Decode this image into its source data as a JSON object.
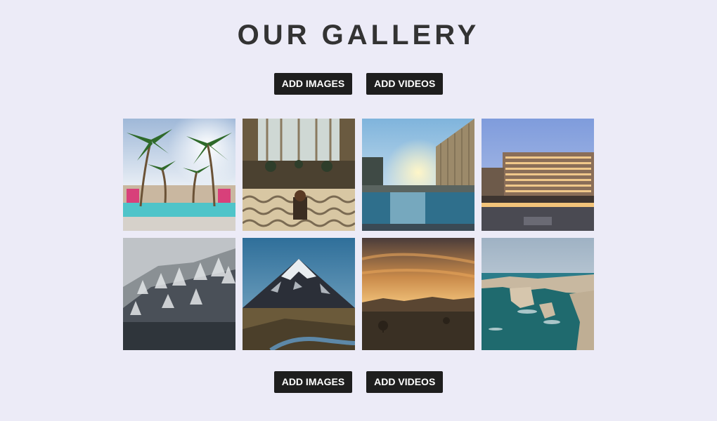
{
  "gallery": {
    "title": "OUR GALLERY",
    "top_buttons": {
      "add_images": "ADD IMAGES",
      "add_videos": "ADD VIDEOS"
    },
    "bottom_buttons": {
      "add_images": "ADD IMAGES",
      "add_videos": "ADD VIDEOS"
    },
    "images": [
      {
        "subject": "palm-pool"
      },
      {
        "subject": "hotel-lobby"
      },
      {
        "subject": "sunset-pool"
      },
      {
        "subject": "hotel-building"
      },
      {
        "subject": "snowy-forest"
      },
      {
        "subject": "mountain-peak"
      },
      {
        "subject": "sunset-valley"
      },
      {
        "subject": "sea-cliffs"
      }
    ]
  },
  "colors": {
    "background": "#ecebf7",
    "button": "#1e1e1e",
    "title": "#333333"
  }
}
